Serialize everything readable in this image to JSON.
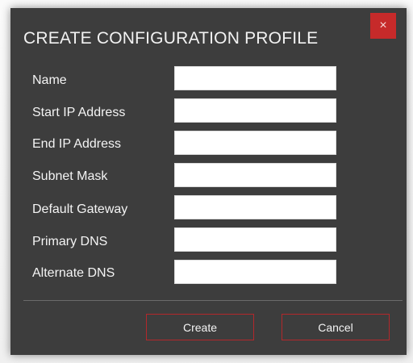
{
  "dialog": {
    "title": "CREATE CONFIGURATION PROFILE",
    "close_glyph": "×",
    "close_icon": "close-icon",
    "accent_color": "#c62a2a"
  },
  "fields": [
    {
      "label": "Name",
      "value": "",
      "placeholder": ""
    },
    {
      "label": "Start IP Address",
      "value": "",
      "placeholder": ""
    },
    {
      "label": "End IP Address",
      "value": "",
      "placeholder": ""
    },
    {
      "label": "Subnet Mask",
      "value": "",
      "placeholder": ""
    },
    {
      "label": "Default Gateway",
      "value": "",
      "placeholder": ""
    },
    {
      "label": "Primary DNS",
      "value": "",
      "placeholder": ""
    },
    {
      "label": "Alternate DNS",
      "value": "",
      "placeholder": ""
    }
  ],
  "buttons": {
    "create_label": "Create",
    "cancel_label": "Cancel"
  }
}
